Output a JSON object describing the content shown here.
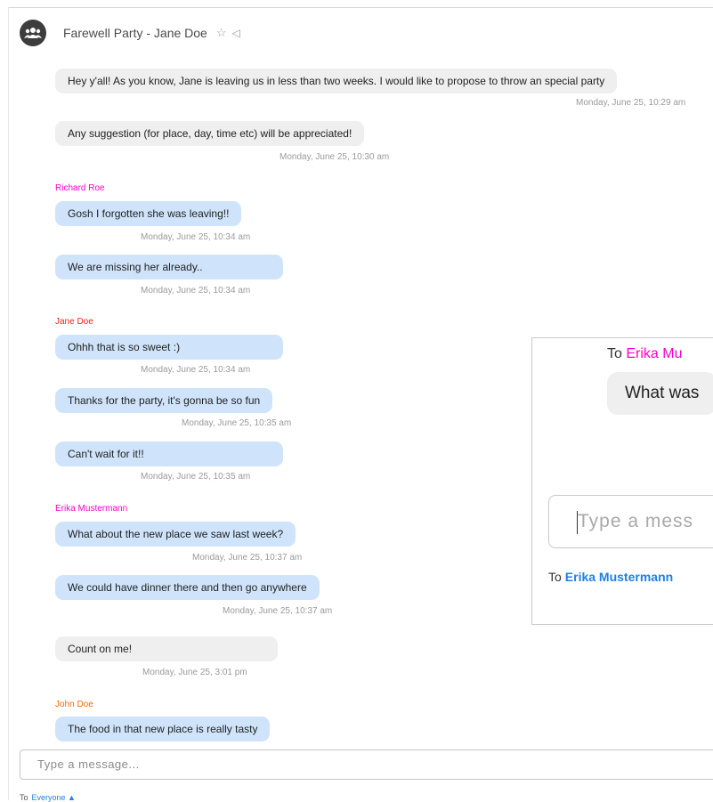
{
  "header": {
    "title": "Farewell Party - Jane Doe",
    "star_icon": "☆",
    "mute_icon": "◁"
  },
  "messages": [
    {
      "text": "Hey y'all! As you know, Jane is leaving us in less than two weeks. I would like to propose to throw an special party",
      "time": "Monday, June 25, 10:29 am"
    },
    {
      "text": "Any suggestion (for place, day, time etc) will be appreciated!",
      "time": "Monday, June 25, 10:30 am"
    },
    {
      "sender": "Richard Roe",
      "sender_color": "#ff00cc"
    },
    {
      "text": "Gosh I forgotten she was leaving!!",
      "time": "Monday, June 25, 10:34 am"
    },
    {
      "text": "We are missing her already..",
      "time": "Monday, June 25, 10:34 am"
    },
    {
      "sender": "Jane Doe",
      "sender_color": "#ff1a1a"
    },
    {
      "text": "Ohhh that is so sweet :)",
      "time": "Monday, June 25, 10:34 am"
    },
    {
      "text": "Thanks for the party, it's gonna be so fun",
      "time": "Monday, June 25, 10:35 am"
    },
    {
      "text": "Can't wait for it!!",
      "time": "Monday, June 25, 10:35 am"
    },
    {
      "sender": "Erika Mustermann",
      "sender_color": "#ff00cc"
    },
    {
      "text": "What about the new place we saw last week?",
      "time": "Monday, June 25, 10:37 am"
    },
    {
      "text": "We could have dinner there and then go anywhere",
      "time": "Monday, June 25, 10:37 am"
    },
    {
      "text": "Count on me!",
      "time": "Monday, June 25, 3:01 pm"
    },
    {
      "sender": "John Doe",
      "sender_color": "#ff6a00"
    },
    {
      "text": "The food in that new place is really tasty"
    }
  ],
  "popup": {
    "to_prefix": "To ",
    "to_name_partial": "Erika Mu",
    "bubble_partial": "What was",
    "input_placeholder_partial": "Type a mess",
    "footer_to": "To",
    "footer_name": "Erika Mustermann"
  },
  "compose": {
    "placeholder": "Type a message...",
    "to_label": "To",
    "to_value": "Everyone ▲"
  }
}
